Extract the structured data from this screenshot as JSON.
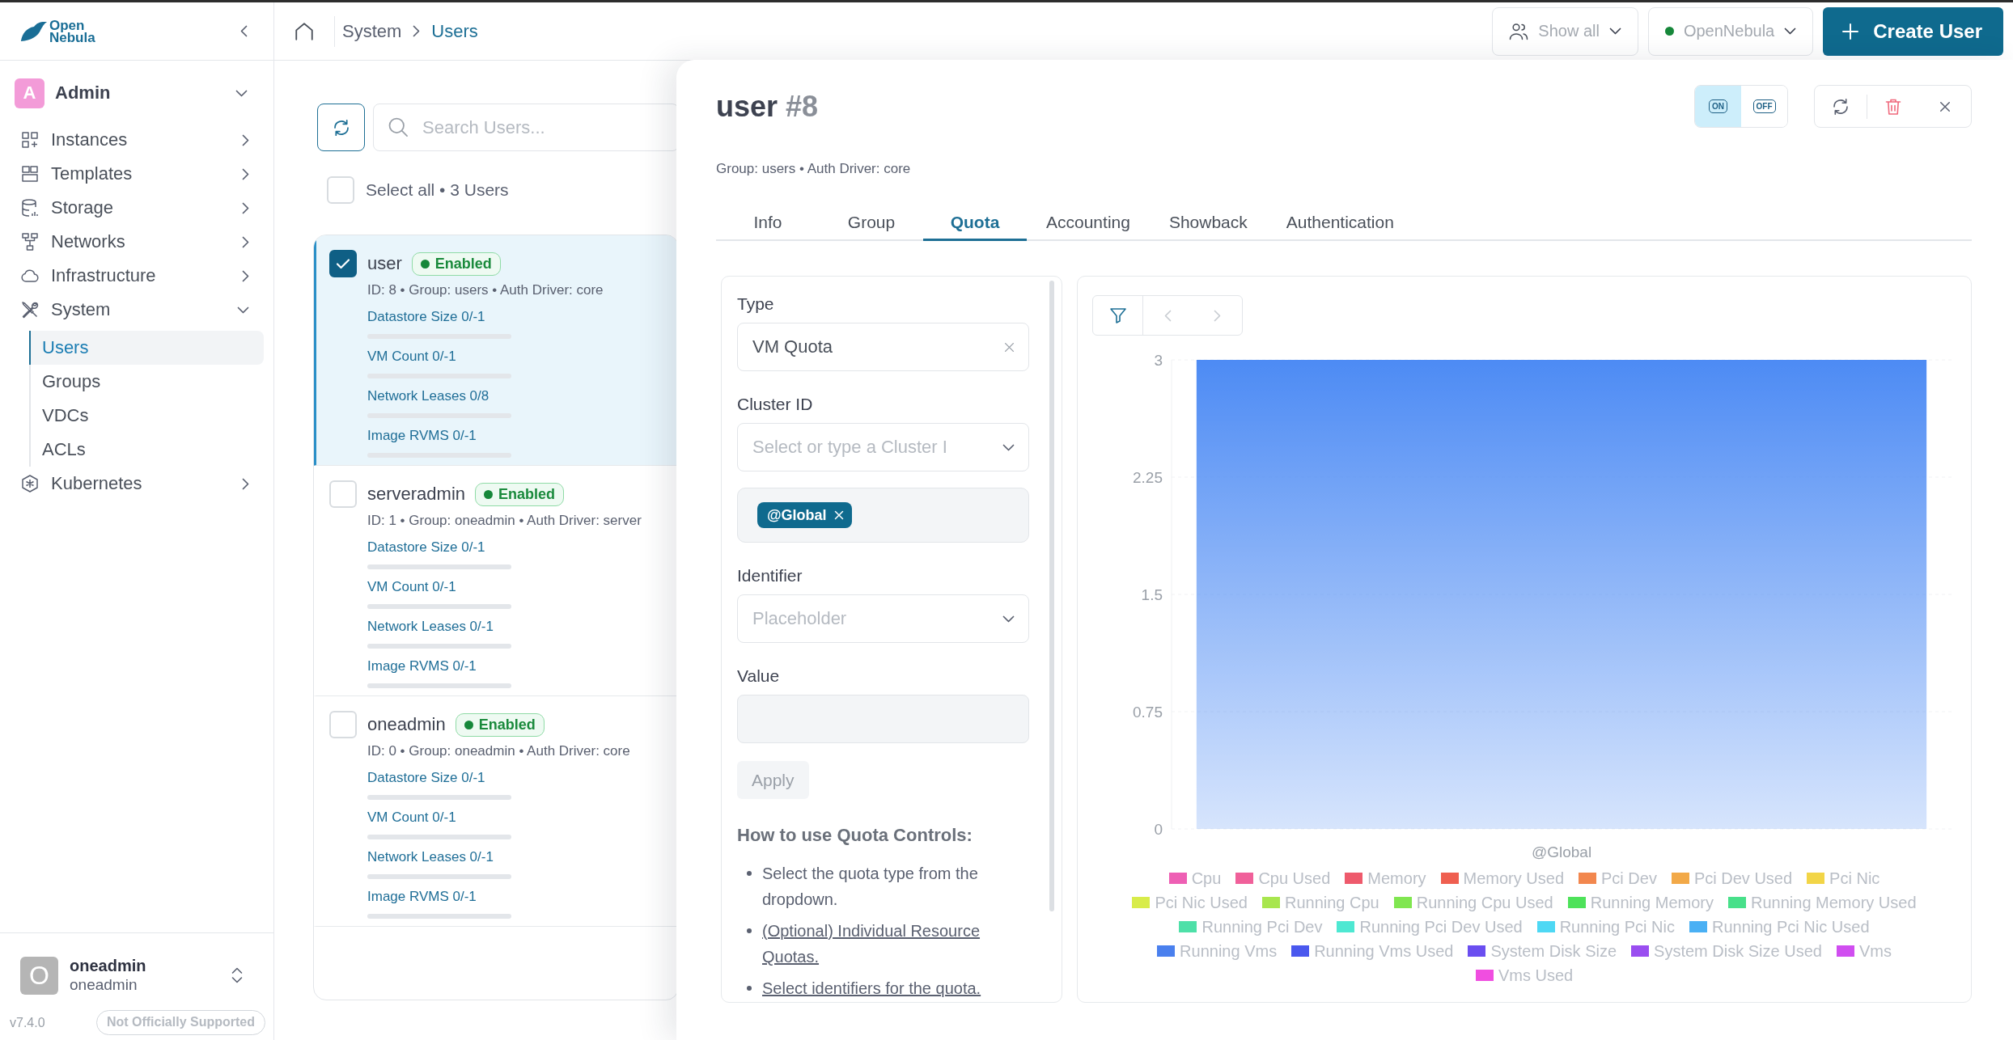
{
  "sidebar": {
    "logo": {
      "line_1": "Open",
      "line_2": "Nebula"
    },
    "account": {
      "initial": "A",
      "name": "Admin"
    },
    "nav": [
      {
        "label": "Instances",
        "expanded": false
      },
      {
        "label": "Templates",
        "expanded": false
      },
      {
        "label": "Storage",
        "expanded": false
      },
      {
        "label": "Networks",
        "expanded": false
      },
      {
        "label": "Infrastructure",
        "expanded": false
      },
      {
        "label": "System",
        "expanded": true,
        "children": [
          {
            "label": "Users",
            "selected": true
          },
          {
            "label": "Groups",
            "selected": false
          },
          {
            "label": "VDCs",
            "selected": false
          },
          {
            "label": "ACLs",
            "selected": false
          }
        ]
      },
      {
        "label": "Kubernetes",
        "expanded": false
      }
    ],
    "user": {
      "initial": "O",
      "name": "oneadmin",
      "group": "oneadmin"
    },
    "version": "v7.4.0",
    "support_badge": "Not Officially Supported"
  },
  "header": {
    "breadcrumb": [
      {
        "label": "System",
        "selected": false
      },
      {
        "label": "Users",
        "selected": true
      }
    ],
    "group_filter": "Show all",
    "zone": "OpenNebula",
    "create_button": "Create User"
  },
  "user_list": {
    "search_placeholder": "Search Users...",
    "select_all": {
      "label": "Select all • 3 Users",
      "checked": false
    },
    "users": [
      {
        "name": "user",
        "status": "Enabled",
        "selected": true,
        "meta": "ID: 8 • Group: users • Auth Driver: core",
        "quotas": [
          {
            "label": "Datastore Size 0/-1",
            "level": 0
          },
          {
            "label": "VM Count 0/-1",
            "level": 0
          },
          {
            "label": "Network Leases 0/8",
            "level": 0
          },
          {
            "label": "Image RVMS 0/-1",
            "level": 0
          }
        ]
      },
      {
        "name": "serveradmin",
        "status": "Enabled",
        "selected": false,
        "meta": "ID: 1 • Group: oneadmin • Auth Driver: server",
        "quotas": [
          {
            "label": "Datastore Size 0/-1",
            "level": 0
          },
          {
            "label": "VM Count 0/-1",
            "level": 0
          },
          {
            "label": "Network Leases 0/-1",
            "level": 0
          },
          {
            "label": "Image RVMS 0/-1",
            "level": 0
          }
        ]
      },
      {
        "name": "oneadmin",
        "status": "Enabled",
        "selected": false,
        "meta": "ID: 0 • Group: oneadmin • Auth Driver: core",
        "quotas": [
          {
            "label": "Datastore Size 0/-1",
            "level": 0
          },
          {
            "label": "VM Count 0/-1",
            "level": 0
          },
          {
            "label": "Network Leases 0/-1",
            "level": 0
          },
          {
            "label": "Image RVMS 0/-1",
            "level": 0
          }
        ]
      }
    ]
  },
  "detail": {
    "title": "user",
    "id": "#8",
    "meta": "Group: users • Auth Driver: core",
    "toggles": [
      {
        "label": "ON",
        "selected": true
      },
      {
        "label": "OFF",
        "selected": false
      }
    ],
    "tabs": [
      {
        "label": "Info",
        "selected": false
      },
      {
        "label": "Group",
        "selected": false
      },
      {
        "label": "Quota",
        "selected": true
      },
      {
        "label": "Accounting",
        "selected": false
      },
      {
        "label": "Showback",
        "selected": false
      },
      {
        "label": "Authentication",
        "selected": false
      }
    ],
    "quota_form": {
      "fields": [
        {
          "kind": "select",
          "label": "Type",
          "value": "VM Quota",
          "clearable": true
        },
        {
          "kind": "select",
          "label": "Cluster ID",
          "placeholder": "Select or type a Cluster I",
          "clearable": false
        },
        {
          "kind": "chips",
          "chips": [
            "@Global"
          ]
        },
        {
          "kind": "select",
          "label": "Identifier",
          "placeholder": "Placeholder",
          "clearable": false
        },
        {
          "kind": "input",
          "label": "Value",
          "disabled": true
        }
      ],
      "apply_button": {
        "label": "Apply",
        "disabled": true
      },
      "help": {
        "title": "How to use Quota Controls:",
        "items": [
          {
            "kind": "text",
            "text": "Select the quota type from the dropdown."
          },
          {
            "kind": "link",
            "text": "(Optional) Individual Resource Quotas."
          },
          {
            "kind": "link",
            "text": "Select identifiers for the quota."
          }
        ]
      }
    },
    "chart": {
      "pager": [
        {
          "kind": "prev",
          "disabled": true
        },
        {
          "kind": "next",
          "disabled": true
        }
      ],
      "chart_data": {
        "type": "bar",
        "categories": [
          "@Global"
        ],
        "values": [
          3
        ],
        "ylim": [
          0,
          3
        ],
        "yticks": [
          0,
          0.75,
          1.5,
          2.25,
          3
        ],
        "grid": true
      },
      "legend": [
        {
          "name": "Cpu",
          "color": "#ee5fb4"
        },
        {
          "name": "Cpu Used",
          "color": "#f0609a"
        },
        {
          "name": "Memory",
          "color": "#ee5a6c"
        },
        {
          "name": "Memory Used",
          "color": "#ef5f50"
        },
        {
          "name": "Pci Dev",
          "color": "#f2874e"
        },
        {
          "name": "Pci Dev Used",
          "color": "#f2a948"
        },
        {
          "name": "Pci Nic",
          "color": "#f2d547"
        },
        {
          "name": "Pci Nic Used",
          "color": "#d8ec4a"
        },
        {
          "name": "Running Cpu",
          "color": "#a8e64e"
        },
        {
          "name": "Running Cpu Used",
          "color": "#80e650"
        },
        {
          "name": "Running Memory",
          "color": "#4ee25a"
        },
        {
          "name": "Running Memory Used",
          "color": "#48e08a"
        },
        {
          "name": "Running Pci Dev",
          "color": "#4ee0a8"
        },
        {
          "name": "Running Pci Dev Used",
          "color": "#4ee8d2"
        },
        {
          "name": "Running Pci Nic",
          "color": "#4ed8f4"
        },
        {
          "name": "Running Pci Nic Used",
          "color": "#4ab0f4"
        },
        {
          "name": "Running Vms",
          "color": "#4a80ee"
        },
        {
          "name": "Running Vms Used",
          "color": "#4a58ee"
        },
        {
          "name": "System Disk Size",
          "color": "#6a4ef0"
        },
        {
          "name": "System Disk Size Used",
          "color": "#9a4ef0"
        },
        {
          "name": "Vms",
          "color": "#d04ef0"
        },
        {
          "name": "Vms Used",
          "color": "#f04ee0"
        }
      ]
    }
  }
}
